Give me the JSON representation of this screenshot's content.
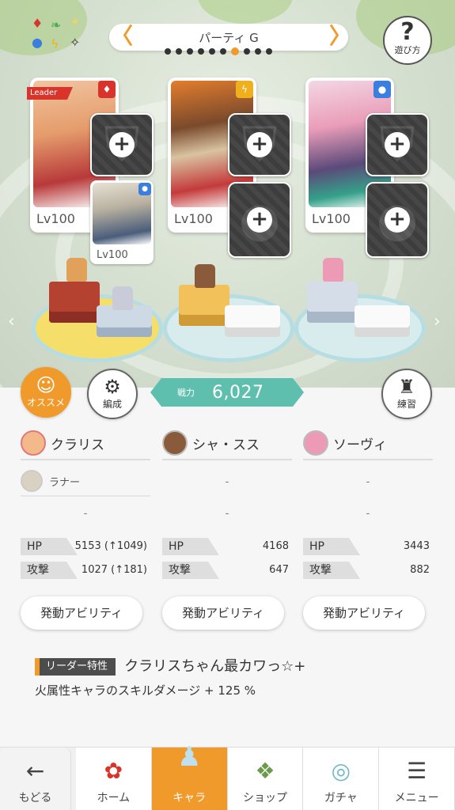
{
  "party": {
    "title": "パーティ G",
    "page_count": 10,
    "active_page": 7,
    "help_label": "遊び方"
  },
  "leader_tag": "Leader",
  "cards": [
    {
      "level": "Lv100",
      "element": "fire",
      "element_color": "#d9342b"
    },
    {
      "level": "Lv100",
      "element": "lightning",
      "element_color": "#f0b01e"
    },
    {
      "level": "Lv100",
      "element": "water",
      "element_color": "#3a7ee0"
    }
  ],
  "sub_card": {
    "level": "Lv100",
    "element": "water"
  },
  "buttons": {
    "recommend": "オススメ",
    "formation": "編成",
    "training": "練習"
  },
  "power": {
    "label": "戦力",
    "value": "6,027"
  },
  "members": [
    {
      "name": "クラリス",
      "sub": "ラナー",
      "sub_dash": "-",
      "hp_label": "HP",
      "hp": "5153 (↑1049)",
      "atk_label": "攻撃",
      "atk": "1027 (↑181)",
      "ability": "発動アビリティ"
    },
    {
      "name": "シャ・スス",
      "sub": "-",
      "sub_dash": "-",
      "hp_label": "HP",
      "hp": "4168",
      "atk_label": "攻撃",
      "atk": "647",
      "ability": "発動アビリティ"
    },
    {
      "name": "ソーヴィ",
      "sub": "-",
      "sub_dash": "-",
      "hp_label": "HP",
      "hp": "3443",
      "atk_label": "攻撃",
      "atk": "882",
      "ability": "発動アビリティ"
    }
  ],
  "leader_skill": {
    "tag": "リーダー特性",
    "name": "クラリスちゃん最カワっ☆+",
    "desc": "火属性キャラのスキルダメージ + 125 %"
  },
  "nav": [
    {
      "label": "もどる",
      "icon": "back-arrow-icon"
    },
    {
      "label": "ホーム",
      "icon": "home-icon"
    },
    {
      "label": "キャラ",
      "icon": "character-icon"
    },
    {
      "label": "ショップ",
      "icon": "shop-icon"
    },
    {
      "label": "ガチャ",
      "icon": "gacha-icon"
    },
    {
      "label": "メニュー",
      "icon": "menu-icon"
    }
  ],
  "colors": {
    "accent": "#f19a2c",
    "power": "#5fbfae",
    "leader": "#d9342b"
  }
}
